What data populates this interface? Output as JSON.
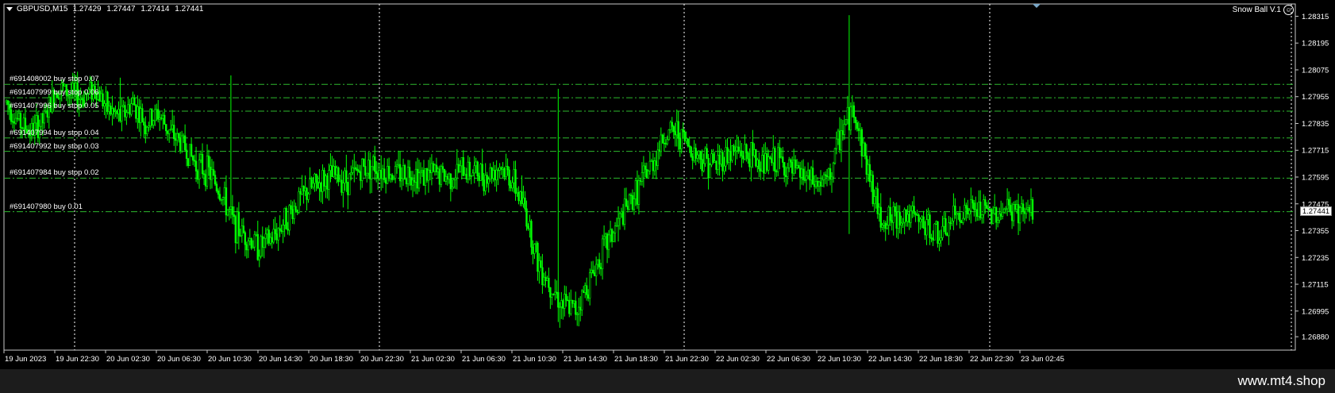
{
  "header": {
    "symbol": "GBPUSD,M15",
    "open": "1.27429",
    "high": "1.27447",
    "low": "1.27414",
    "close": "1.27441"
  },
  "expert_name": "Snow Ball V.1",
  "current_price_label": "1.27441",
  "footer": {
    "site": "www.mt4.shop"
  },
  "colors": {
    "background": "#000000",
    "candles": "#00ff00",
    "order_lines": "#2db82d",
    "grid": "#ffffff",
    "text": "#ffffff"
  },
  "orders": [
    {
      "label": "#691408002 buy stop 0.07",
      "price": 1.2801
    },
    {
      "label": "#691407999 buy stop 0.06",
      "price": 1.2795
    },
    {
      "label": "#691407996 buy stop 0.05",
      "price": 1.2789
    },
    {
      "label": "#691407994 buy stop 0.04",
      "price": 1.2777
    },
    {
      "label": "#691407992 buy stop 0.03",
      "price": 1.2771
    },
    {
      "label": "#691407984 buy stop 0.02",
      "price": 1.2759
    },
    {
      "label": "#691407980 buy 0.01",
      "price": 1.2744
    }
  ],
  "chart_data": {
    "type": "candlestick",
    "symbol": "GBPUSD",
    "timeframe": "M15",
    "ylim": [
      1.2682,
      1.2837
    ],
    "price_ticks": [
      "1.28315",
      "1.28195",
      "1.28075",
      "1.27955",
      "1.27835",
      "1.27715",
      "1.27595",
      "1.27475",
      "1.27355",
      "1.27235",
      "1.27115",
      "1.26995",
      "1.26880"
    ],
    "time_ticks": [
      "19 Jun 2023",
      "19 Jun 22:30",
      "20 Jun 02:30",
      "20 Jun 06:30",
      "20 Jun 10:30",
      "20 Jun 14:30",
      "20 Jun 18:30",
      "20 Jun 22:30",
      "21 Jun 02:30",
      "21 Jun 06:30",
      "21 Jun 10:30",
      "21 Jun 14:30",
      "21 Jun 18:30",
      "21 Jun 22:30",
      "22 Jun 02:30",
      "22 Jun 06:30",
      "22 Jun 10:30",
      "22 Jun 14:30",
      "22 Jun 18:30",
      "22 Jun 22:30",
      "23 Jun 02:45"
    ],
    "price_path": [
      [
        0,
        1.2793
      ],
      [
        8,
        1.2784
      ],
      [
        16,
        1.278
      ],
      [
        24,
        1.2785
      ],
      [
        32,
        1.28
      ],
      [
        40,
        1.2797
      ],
      [
        48,
        1.2795
      ],
      [
        56,
        1.28
      ],
      [
        64,
        1.279
      ],
      [
        72,
        1.2786
      ],
      [
        80,
        1.2793
      ],
      [
        88,
        1.2783
      ],
      [
        96,
        1.2788
      ],
      [
        104,
        1.2779
      ],
      [
        112,
        1.2774
      ],
      [
        120,
        1.2765
      ],
      [
        128,
        1.2762
      ],
      [
        136,
        1.2752
      ],
      [
        144,
        1.2738
      ],
      [
        152,
        1.2733
      ],
      [
        160,
        1.2728
      ],
      [
        168,
        1.2732
      ],
      [
        176,
        1.274
      ],
      [
        184,
        1.2748
      ],
      [
        192,
        1.2754
      ],
      [
        200,
        1.2758
      ],
      [
        208,
        1.276
      ],
      [
        216,
        1.2758
      ],
      [
        224,
        1.2763
      ],
      [
        232,
        1.2765
      ],
      [
        240,
        1.2762
      ],
      [
        248,
        1.2761
      ],
      [
        256,
        1.2762
      ],
      [
        264,
        1.276
      ],
      [
        272,
        1.2761
      ],
      [
        280,
        1.2759
      ],
      [
        288,
        1.2763
      ],
      [
        296,
        1.2762
      ],
      [
        304,
        1.276
      ],
      [
        312,
        1.2765
      ],
      [
        320,
        1.2758
      ],
      [
        328,
        1.2745
      ],
      [
        336,
        1.2722
      ],
      [
        344,
        1.2712
      ],
      [
        352,
        1.2702
      ],
      [
        360,
        1.27
      ],
      [
        368,
        1.2712
      ],
      [
        376,
        1.2725
      ],
      [
        384,
        1.2735
      ],
      [
        392,
        1.2745
      ],
      [
        400,
        1.2755
      ],
      [
        408,
        1.2765
      ],
      [
        416,
        1.2778
      ],
      [
        424,
        1.278
      ],
      [
        432,
        1.2773
      ],
      [
        440,
        1.2768
      ],
      [
        448,
        1.2765
      ],
      [
        456,
        1.277
      ],
      [
        464,
        1.2771
      ],
      [
        472,
        1.2768
      ],
      [
        480,
        1.2765
      ],
      [
        488,
        1.2767
      ],
      [
        496,
        1.2762
      ],
      [
        504,
        1.276
      ],
      [
        512,
        1.2756
      ],
      [
        520,
        1.2758
      ],
      [
        528,
        1.278
      ],
      [
        536,
        1.279
      ],
      [
        544,
        1.2765
      ],
      [
        552,
        1.2742
      ],
      [
        560,
        1.274
      ],
      [
        568,
        1.2743
      ],
      [
        576,
        1.274
      ],
      [
        584,
        1.2736
      ],
      [
        592,
        1.2733
      ],
      [
        600,
        1.2742
      ],
      [
        608,
        1.2745
      ],
      [
        616,
        1.2744
      ],
      [
        624,
        1.2743
      ],
      [
        632,
        1.2745
      ],
      [
        640,
        1.2744
      ]
    ],
    "high_spikes": [
      {
        "index": 72,
        "price": 1.2804
      },
      {
        "index": 142,
        "price": 1.2805
      },
      {
        "index": 349,
        "price": 1.2799
      },
      {
        "index": 533,
        "price": 1.2832
      }
    ],
    "low_spikes": [
      {
        "index": 350,
        "price": 1.2692
      },
      {
        "index": 533,
        "price": 1.2734
      }
    ]
  }
}
